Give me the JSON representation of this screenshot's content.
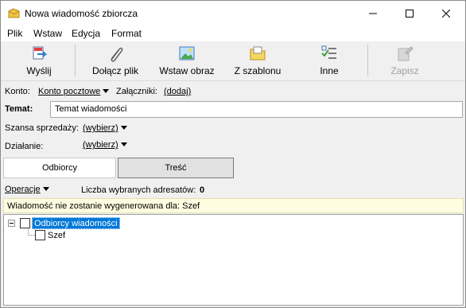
{
  "window": {
    "title": "Nowa wiadomość zbiorcza"
  },
  "menu": [
    "Plik",
    "Wstaw",
    "Edycja",
    "Format"
  ],
  "toolbar": {
    "send": "Wyślij",
    "attach": "Dołącz plik",
    "insert_image": "Wstaw obraz",
    "from_template": "Z szablonu",
    "other": "Inne",
    "save": "Zapisz"
  },
  "form": {
    "account_label": "Konto:",
    "account_value": "Konto pocztowe",
    "attachments_label": "Załączniki:",
    "attachments_value": "(dodaj)",
    "subject_label": "Temat:",
    "subject_value": "Temat wiadomości",
    "sales_chance_label": "Szansa sprzedaży:",
    "sales_chance_value": "(wybierz)",
    "action_label": "Działanie:",
    "action_value": "(wybierz)"
  },
  "tabs": {
    "recipients": "Odbiorcy",
    "content": "Treść"
  },
  "recipients": {
    "operations": "Operacje",
    "count_label": "Liczba wybranych adresatów:",
    "count_value": "0",
    "warning": "Wiadomość nie zostanie wygenerowana dla: Szef",
    "tree_root": "Odbiorcy wiadomości",
    "tree_child": "Szef"
  },
  "colors": {
    "selection": "#0078d7",
    "info_bg": "#fffde1"
  }
}
